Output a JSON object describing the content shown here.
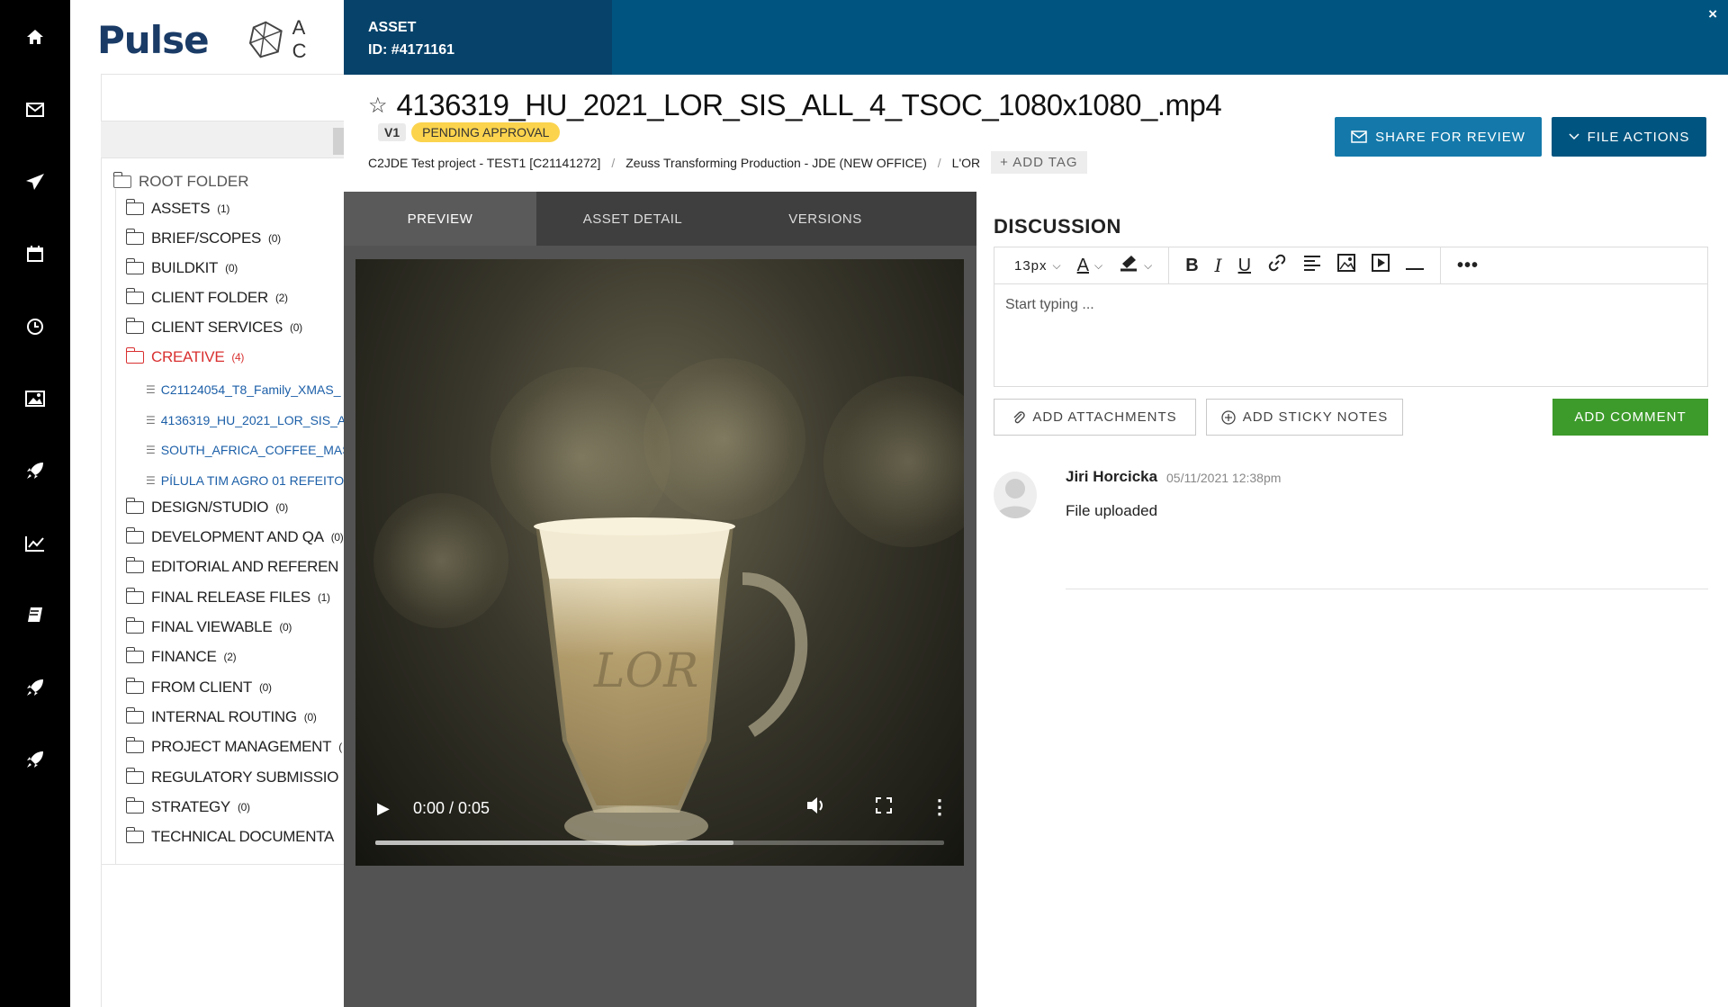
{
  "rail": {
    "icons": [
      "home-icon",
      "mail-icon",
      "send-icon",
      "calendar-icon",
      "clock-icon",
      "image-icon",
      "rocket-icon",
      "chart-icon",
      "book-icon",
      "rocket-icon",
      "rocket-icon"
    ]
  },
  "background_app": {
    "logo": "Pulse",
    "logo_secondary": "A C",
    "tree": {
      "root": "ROOT FOLDER",
      "folders": [
        {
          "name": "ASSETS",
          "count": "(1)"
        },
        {
          "name": "BRIEF/SCOPES",
          "count": "(0)"
        },
        {
          "name": "BUILDKIT",
          "count": "(0)"
        },
        {
          "name": "CLIENT FOLDER",
          "count": "(2)"
        },
        {
          "name": "CLIENT SERVICES",
          "count": "(0)"
        },
        {
          "name": "CREATIVE",
          "count": "(4)"
        },
        {
          "name": "DESIGN/STUDIO",
          "count": "(0)"
        },
        {
          "name": "DEVELOPMENT AND QA",
          "count": "(0)"
        },
        {
          "name": "EDITORIAL AND REFEREN",
          "count": ""
        },
        {
          "name": "FINAL RELEASE FILES",
          "count": "(1)"
        },
        {
          "name": "FINAL VIEWABLE",
          "count": "(0)"
        },
        {
          "name": "FINANCE",
          "count": "(2)"
        },
        {
          "name": "FROM CLIENT",
          "count": "(0)"
        },
        {
          "name": "INTERNAL ROUTING",
          "count": "(0)"
        },
        {
          "name": "PROJECT MANAGEMENT",
          "count": "("
        },
        {
          "name": "REGULATORY SUBMISSIO",
          "count": ""
        },
        {
          "name": "STRATEGY",
          "count": "(0)"
        },
        {
          "name": "TECHNICAL DOCUMENTA",
          "count": ""
        }
      ],
      "files": [
        "C21124054_T8_Family_XMAS_",
        "4136319_HU_2021_LOR_SIS_A",
        "SOUTH_AFRICA_COFFEE_MAS",
        "PÍLULA TIM AGRO 01 REFEITO"
      ]
    }
  },
  "modal": {
    "header": {
      "label": "ASSET",
      "id": "ID: #4171161",
      "close": "×"
    },
    "title": "4136319_HU_2021_LOR_SIS_ALL_4_TSOC_1080x1080_.mp4",
    "version": "V1",
    "status": "PENDING APPROVAL",
    "breadcrumbs": [
      "C2JDE Test project - TEST1 [C21141272]",
      "Zeuss Transforming Production - JDE (NEW OFFICE)",
      "L'OR"
    ],
    "add_tag": "+ ADD TAG",
    "share_button": "SHARE FOR REVIEW",
    "actions_button": "FILE ACTIONS",
    "tabs": [
      "PREVIEW",
      "ASSET DETAIL",
      "VERSIONS"
    ],
    "video": {
      "time": "0:00 / 0:05",
      "progress": 0.63,
      "cup_logo": "LOR"
    },
    "discussion": {
      "title": "DISCUSSION",
      "font_size": "13px",
      "placeholder": "Start typing ...",
      "attach_button": "ADD ATTACHMENTS",
      "sticky_button": "ADD STICKY NOTES",
      "comment_button": "ADD COMMENT",
      "comments": [
        {
          "author": "Jiri Horcicka",
          "date": "05/11/2021 12:38pm",
          "text": "File uploaded"
        }
      ]
    }
  },
  "colors": {
    "header": "#005580",
    "header_id_box": "#06426a",
    "share_button": "#1479aa",
    "comment_button": "#3d9b2b",
    "status_badge": "#fbd34d",
    "active_folder": "#d93030"
  }
}
